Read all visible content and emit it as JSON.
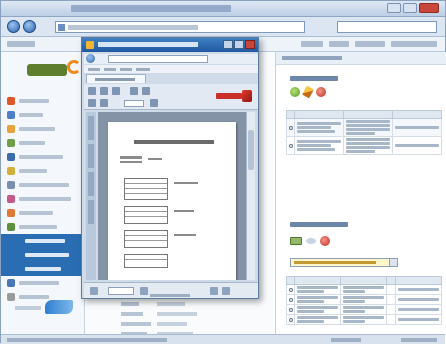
{
  "browser": {
    "title": "",
    "address": "",
    "search_placeholder": ""
  },
  "app": {
    "logo_text": ""
  },
  "popup": {
    "title": "",
    "address": "",
    "zoom": "",
    "page_indicator": "",
    "document_title": ""
  },
  "right_panel": {
    "heading": "",
    "section_top_title": "",
    "section_bottom_title": "",
    "combo_value": ""
  },
  "status_bar": {
    "url": ""
  },
  "colors": {
    "window_frame": "#8aa2bd",
    "popup_titlebar": "#2059a0",
    "selected_nav": "#2b6db2",
    "brand_orange": "#f08a1c",
    "pdf_red": "#c9302c",
    "combo_highlight": "#fff7c9"
  }
}
